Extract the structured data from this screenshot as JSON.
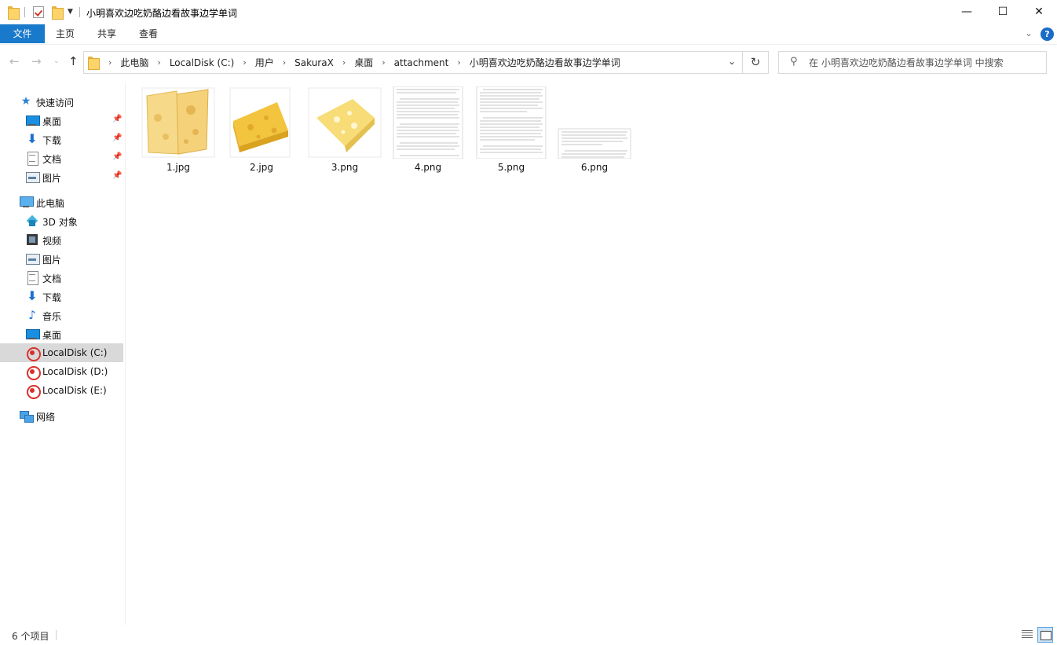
{
  "window": {
    "title": "小明喜欢边吃奶酪边看故事边学单词",
    "minimize_glyph": "—",
    "maximize_glyph": "☐",
    "close_glyph": "✕"
  },
  "ribbon": {
    "tabs": [
      {
        "label": "文件"
      },
      {
        "label": "主页"
      },
      {
        "label": "共享"
      },
      {
        "label": "查看"
      }
    ],
    "help_glyph": "?"
  },
  "address": {
    "crumbs": [
      "此电脑",
      "LocalDisk (C:)",
      "用户",
      "SakuraX",
      "桌面",
      "attachment",
      "小明喜欢边吃奶酪边看故事边学单词"
    ]
  },
  "search": {
    "placeholder": "在 小明喜欢边吃奶酪边看故事边学单词 中搜索"
  },
  "sidebar": {
    "quick_access": "快速访问",
    "quick_items": [
      {
        "label": "桌面",
        "icon": "desktop-icon"
      },
      {
        "label": "下载",
        "icon": "download-icon"
      },
      {
        "label": "文档",
        "icon": "document-icon"
      },
      {
        "label": "图片",
        "icon": "pictures-icon"
      }
    ],
    "this_pc": "此电脑",
    "pc_items": [
      {
        "label": "3D 对象",
        "icon": "3d-objects-icon"
      },
      {
        "label": "视频",
        "icon": "videos-icon"
      },
      {
        "label": "图片",
        "icon": "pictures-icon"
      },
      {
        "label": "文档",
        "icon": "document-icon"
      },
      {
        "label": "下载",
        "icon": "download-icon"
      },
      {
        "label": "音乐",
        "icon": "music-icon"
      },
      {
        "label": "桌面",
        "icon": "desktop-icon"
      },
      {
        "label": "LocalDisk (C:)",
        "icon": "disk-icon"
      },
      {
        "label": "LocalDisk (D:)",
        "icon": "disk-icon"
      },
      {
        "label": "LocalDisk (E:)",
        "icon": "disk-icon"
      }
    ],
    "network": "网络"
  },
  "files": [
    {
      "name": "1.jpg",
      "kind": "cheese-slices-image"
    },
    {
      "name": "2.jpg",
      "kind": "cheese-wedge-image"
    },
    {
      "name": "3.png",
      "kind": "cheese-piece-image"
    },
    {
      "name": "4.png",
      "kind": "text-page-image"
    },
    {
      "name": "5.png",
      "kind": "text-page-image"
    },
    {
      "name": "6.png",
      "kind": "text-page-image"
    }
  ],
  "status": {
    "count": "6 个项目"
  },
  "colors": {
    "accent": "#1979ca",
    "selection": "#d9d9d9"
  }
}
